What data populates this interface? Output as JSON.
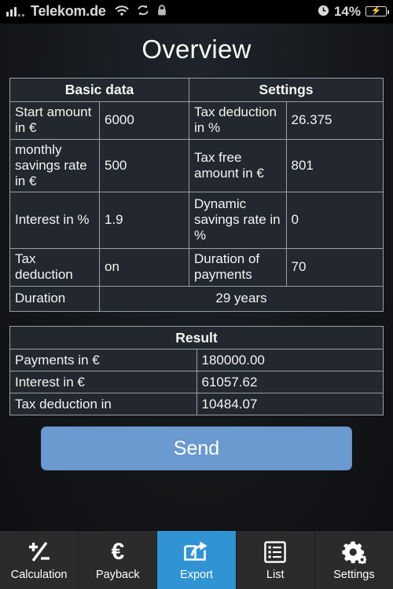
{
  "status_bar": {
    "carrier": "Telekom.de",
    "icons": [
      "signal-bars-icon",
      "wifi-icon",
      "sync-icon",
      "lock-icon",
      "clock-icon"
    ],
    "battery_percent": "14%",
    "battery_state": "charging"
  },
  "header": {
    "title": "Overview"
  },
  "basic_table": {
    "headers": [
      "Basic data",
      "Settings"
    ],
    "left_rows": [
      {
        "label": "Start amount in €",
        "value": "6000"
      },
      {
        "label": "monthly savings rate in €",
        "value": "500"
      },
      {
        "label": "Interest in %",
        "value": "1.9"
      },
      {
        "label": "Tax deduction",
        "value": "on"
      }
    ],
    "right_rows": [
      {
        "label": "Tax deduction in %",
        "value": "26.375"
      },
      {
        "label": "Tax free amount in €",
        "value": "801"
      },
      {
        "label": "Dynamic savings rate in %",
        "value": "0"
      },
      {
        "label": "Duration of payments",
        "value": "70"
      }
    ],
    "footer_row": {
      "label": "Duration",
      "value": "29 years"
    }
  },
  "result_table": {
    "header": "Result",
    "rows": [
      {
        "label": "Payments in €",
        "value": "180000.00"
      },
      {
        "label": "Interest in €",
        "value": "61057.62"
      },
      {
        "label": "Tax deduction in",
        "value": "10484.07"
      }
    ]
  },
  "send_button": {
    "label": "Send"
  },
  "tab_bar": {
    "tabs": [
      {
        "label": "Calculation",
        "icon": "plus-minus-icon",
        "active": false
      },
      {
        "label": "Payback",
        "icon": "euro-icon",
        "active": false
      },
      {
        "label": "Export",
        "icon": "export-share-icon",
        "active": true
      },
      {
        "label": "List",
        "icon": "list-icon",
        "active": false
      },
      {
        "label": "Settings",
        "icon": "gear-icon",
        "active": false
      }
    ]
  },
  "colors": {
    "accent_active_tab": "#3094d4",
    "send_button": "#6a9ad0",
    "table_background": "#23272e",
    "table_border": "#9a9fa6",
    "page_background": "#141619"
  }
}
